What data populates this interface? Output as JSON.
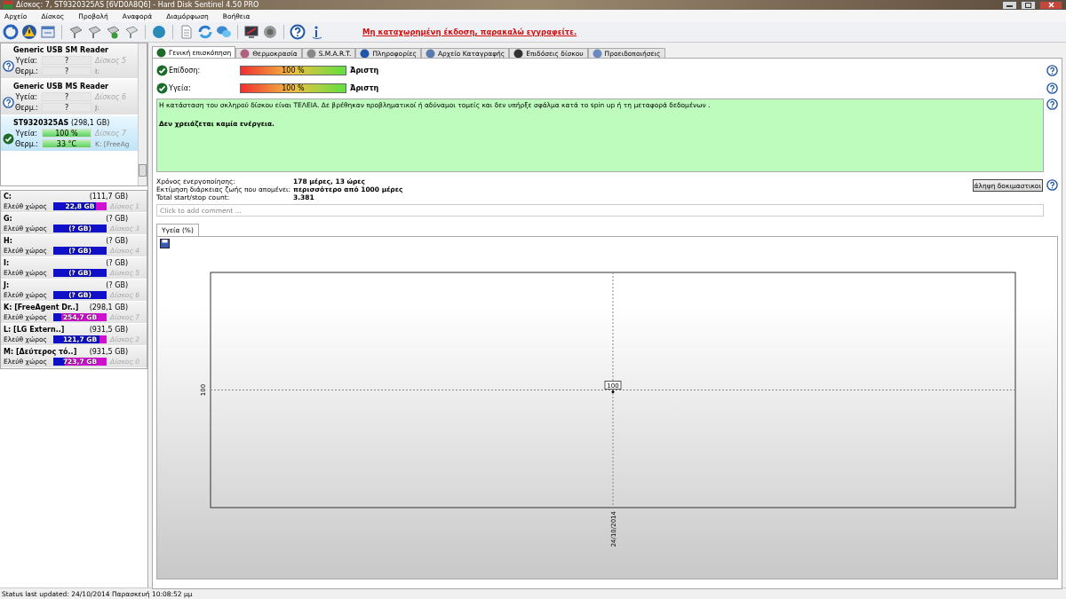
{
  "window": {
    "title": "Δίσκος: 7, ST9320325AS [6VD0A8Q6]  -  Hard Disk Sentinel 4.50 PRO"
  },
  "menu": [
    "Αρχείο",
    "Δίσκος",
    "Προβολή",
    "Αναφορά",
    "Διαμόρφωση",
    "Βοήθεια"
  ],
  "register_link": "Μη καταχωρημένη έκδοση, παρακαλώ εγγραφείτε.",
  "devices": [
    {
      "name": "Generic USB SM Reader",
      "kind": "unknown",
      "selected": false,
      "health": {
        "label": "Υγεία:",
        "reading": "?"
      },
      "temp": {
        "label": "Θερμ.:",
        "reading": "?"
      },
      "disk": "Δίσκος 5",
      "drive": "I:"
    },
    {
      "name": "Generic USB MS Reader",
      "kind": "unknown",
      "selected": false,
      "health": {
        "label": "Υγεία:",
        "reading": "?"
      },
      "temp": {
        "label": "Θερμ.:",
        "reading": "?"
      },
      "disk": "Δίσκος 6",
      "drive": "J:"
    },
    {
      "name": "ST9320325AS",
      "size": "(298,1 GB)",
      "kind": "ok",
      "selected": true,
      "health": {
        "label": "Υγεία:",
        "reading": "100 %",
        "level": 1
      },
      "temp": {
        "label": "Θερμ.:",
        "reading": "33 °C",
        "level": 1
      },
      "disk": "Δίσκος 7",
      "drive": "K: [FreeAg"
    }
  ],
  "volumes": [
    {
      "name": "C:",
      "size": "(111,7 GB)",
      "label": "Ελεύθ χώρος",
      "free": "22,8 GB",
      "level": 0.2,
      "disk": "Δίσκος 1"
    },
    {
      "name": "G:",
      "size": "(? GB)",
      "label": "Ελεύθ χώρος",
      "free": "(? GB)",
      "disk": "Δίσκος 3"
    },
    {
      "name": "H:",
      "size": "(? GB)",
      "label": "Ελεύθ χώρος",
      "free": "(? GB)",
      "disk": "Δίσκος 4"
    },
    {
      "name": "I:",
      "size": "(? GB)",
      "label": "Ελεύθ χώρος",
      "free": "(? GB)",
      "disk": "Δίσκος 5"
    },
    {
      "name": "J:",
      "size": "(? GB)",
      "label": "Ελεύθ χώρος",
      "free": "(? GB)",
      "disk": "Δίσκος 6"
    },
    {
      "name": "K: [FreeAgent Dr..]",
      "size": "(298,1 GB)",
      "label": "Ελεύθ χώρος",
      "free": "254,7 GB",
      "level": 0.85,
      "disk": "Δίσκος 7"
    },
    {
      "name": "L: [LG Extern..]",
      "size": "(931,5 GB)",
      "label": "Ελεύθ χώρος",
      "free": "121,7 GB",
      "level": 0.13,
      "disk": "Δίσκος 2"
    },
    {
      "name": "M: [Δεύτερος τό..]",
      "size": "(931,5 GB)",
      "label": "Ελεύθ χώρος",
      "free": "723,7 GB",
      "level": 0.78,
      "disk": "Δίσκος 0"
    }
  ],
  "tabs": [
    {
      "label": "Γενική επισκόπηση",
      "selected": true
    },
    {
      "label": "Θερμοκρασία",
      "selected": false
    },
    {
      "label": "S.M.A.R.T.",
      "selected": false
    },
    {
      "label": "Πληροφορίες",
      "selected": false
    },
    {
      "label": "Αρχείο Καταγραφής",
      "selected": false
    },
    {
      "label": "Επιδόσεις δίσκου",
      "selected": false
    },
    {
      "label": "Προειδοποιήσεις",
      "selected": false
    }
  ],
  "meters": [
    {
      "label": "Επίδοση:",
      "reading": "100 %",
      "level": 1,
      "rating": "Άριστη"
    },
    {
      "label": "Υγεία:",
      "reading": "100 %",
      "level": 1,
      "rating": "Άριστη"
    }
  ],
  "status_text": "Η κατάσταση του σκληρού δίσκου είναι ΤΕΛΕΙΑ. Δε βρέθηκαν προβληματικοί ή αδύναμοι τομείς και δεν υπήρξε σφάλμα κατά το spin up ή τη μεταφορά δεδομένων .",
  "status_action": "Δεν χρειάζεται καμία ενέργεια.",
  "facts": [
    {
      "label": "Χρόνος ενεργοποίησης:",
      "value": "178 μέρες, 13 ώρες"
    },
    {
      "label": "Εκτίμηση διάρκειας ζωής που απομένει:",
      "value": "περισσότερο από 1000 μέρες"
    },
    {
      "label": "Total start/stop count:",
      "value": "3.381"
    }
  ],
  "test_button": "άληψη δοκιμαστικοι",
  "comment": {
    "placeholder": "Click to add comment ..."
  },
  "chart_tab": {
    "label": "Υγεία (%)",
    "selected": true
  },
  "chart": {
    "kind": "scatter",
    "y_tick": "100",
    "x_tick": "24/10/2014",
    "point_label": "100"
  },
  "status_bar": "Status last updated: 24/10/2014 Παρασκευή 10:08:52 μμ"
}
